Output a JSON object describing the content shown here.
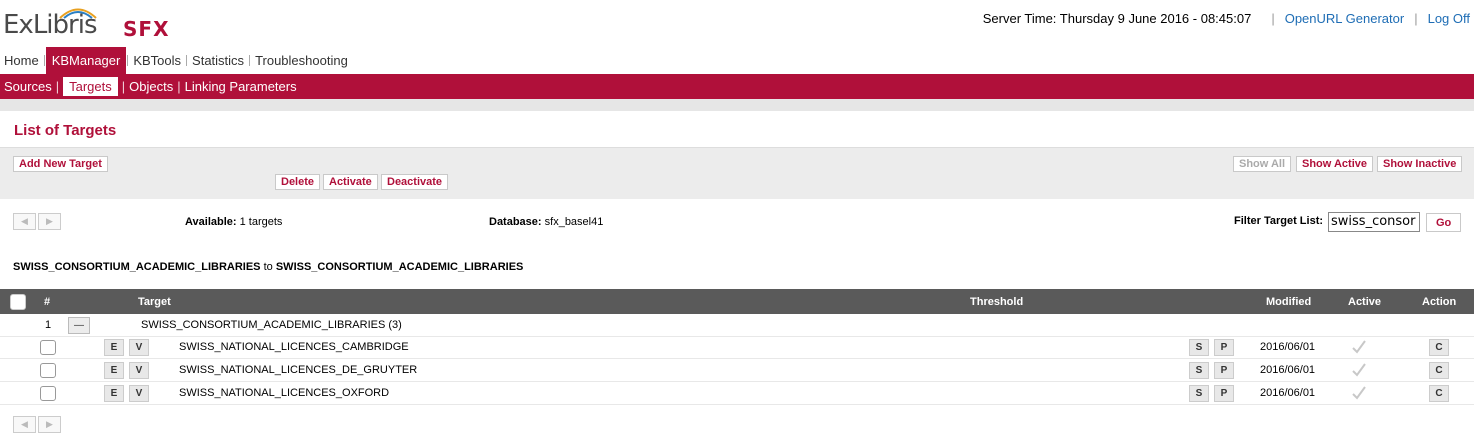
{
  "header": {
    "logo_main": "ExLibris",
    "logo_sub": "SFX",
    "server_time": "Server Time: Thursday 9 June 2016 - 08:45:07",
    "links": [
      "OpenURL Generator",
      "Log Off"
    ],
    "colors": {
      "brand": "#b0103a",
      "link": "#1e6db5"
    }
  },
  "topnav": {
    "items": [
      "Home",
      "KBManager",
      "KBTools",
      "Statistics",
      "Troubleshooting"
    ],
    "active": "KBManager"
  },
  "subnav": {
    "items": [
      "Sources",
      "Targets",
      "Objects",
      "Linking Parameters"
    ],
    "active": "Targets"
  },
  "page": {
    "title": "List of Targets"
  },
  "toolbar": {
    "add_new": "Add New Target",
    "delete": "Delete",
    "activate": "Activate",
    "deactivate": "Deactivate",
    "show_all": "Show All",
    "show_active": "Show Active",
    "show_inactive": "Show Inactive"
  },
  "info": {
    "available_label": "Available:",
    "available_value": "1 targets",
    "database_label": "Database:",
    "database_value": "sfx_basel41",
    "filter_label": "Filter Target List:",
    "filter_value": "swiss_consor",
    "go": "Go"
  },
  "range": {
    "from": "SWISS_CONSORTIUM_ACADEMIC_LIBRARIES",
    "to_word": "to",
    "to": "SWISS_CONSORTIUM_ACADEMIC_LIBRARIES"
  },
  "table": {
    "headers": {
      "num": "#",
      "target": "Target",
      "threshold": "Threshold",
      "modified": "Modified",
      "active": "Active",
      "action": "Action"
    },
    "group": {
      "num": "1",
      "collapse": "—",
      "name": "SWISS_CONSORTIUM_ACADEMIC_LIBRARIES (3)"
    },
    "rows": [
      {
        "e": "E",
        "v": "V",
        "name": "SWISS_NATIONAL_LICENCES_CAMBRIDGE",
        "s": "S",
        "p": "P",
        "modified": "2016/06/01",
        "action": "C"
      },
      {
        "e": "E",
        "v": "V",
        "name": "SWISS_NATIONAL_LICENCES_DE_GRUYTER",
        "s": "S",
        "p": "P",
        "modified": "2016/06/01",
        "action": "C"
      },
      {
        "e": "E",
        "v": "V",
        "name": "SWISS_NATIONAL_LICENCES_OXFORD",
        "s": "S",
        "p": "P",
        "modified": "2016/06/01",
        "action": "C"
      }
    ]
  },
  "icons": {
    "arrow_left": "◀",
    "arrow_right": "▶"
  }
}
